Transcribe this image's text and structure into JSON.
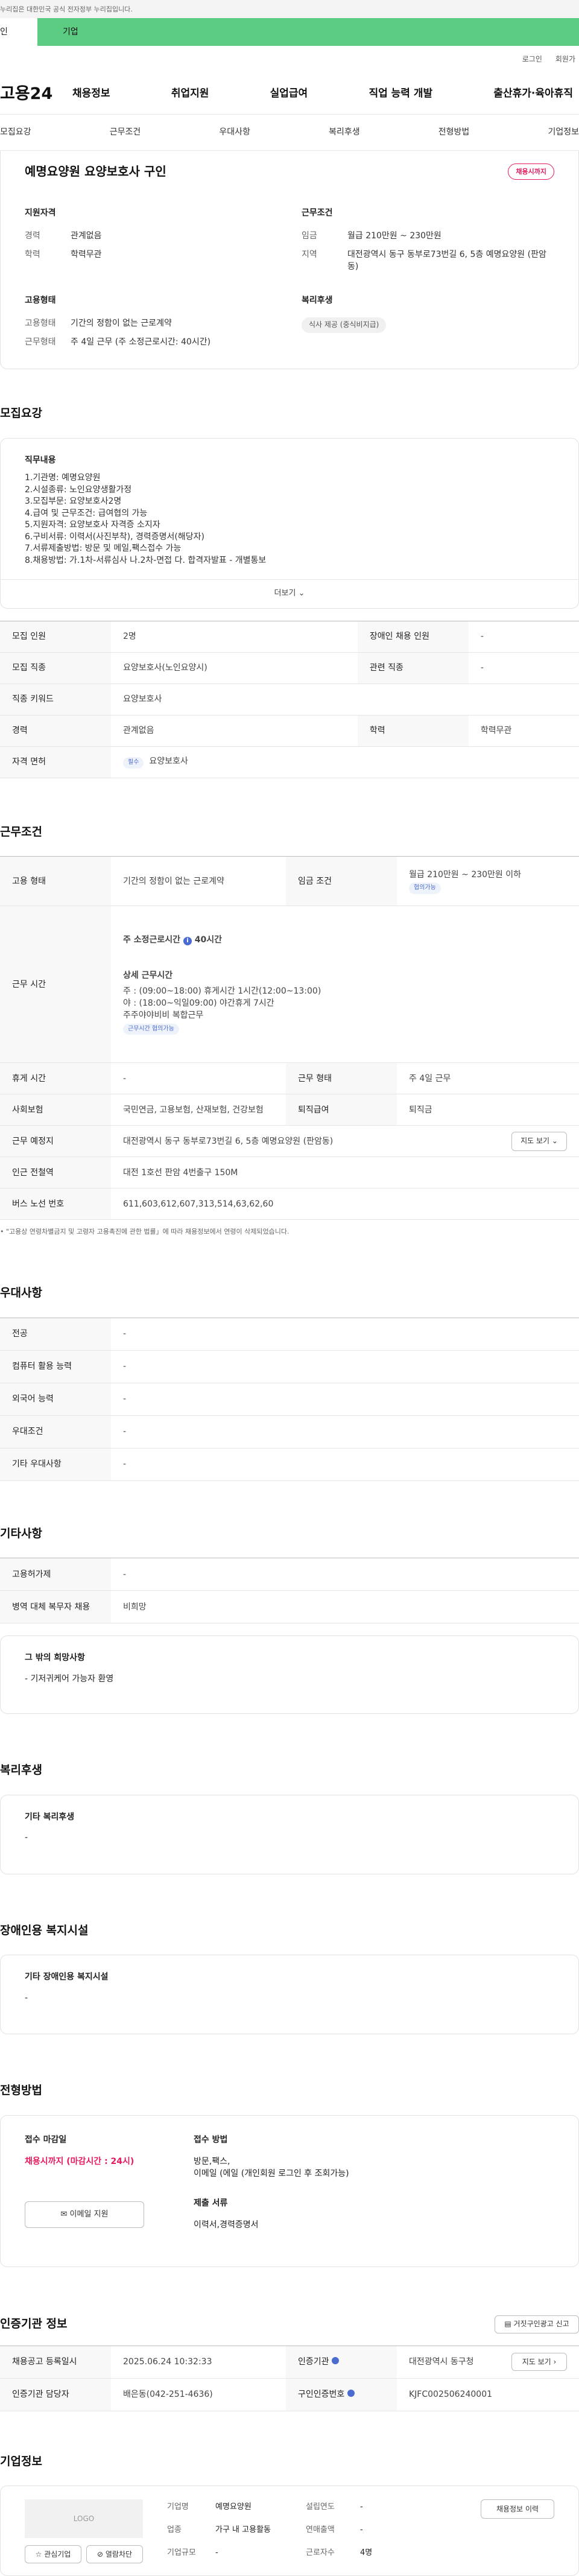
{
  "gov_banner": "누리집은 대한민국 공식 전자정부 누리집입니다.",
  "site_tabs": [
    "인",
    "기업"
  ],
  "util_links": [
    "로그인",
    "회원가"
  ],
  "logo": "고용24",
  "gnb": [
    "채용정보",
    "취업지원",
    "실업급여",
    "직업 능력 개발",
    "출산휴가·육아휴직"
  ],
  "anchors": [
    "모집요강",
    "근무조건",
    "우대사항",
    "복리후생",
    "전형방법",
    "기업정보"
  ],
  "job_title": "예명요양원 요양보호사 구인",
  "status_badge": "채용시까지",
  "summary": {
    "qual_title": "지원자격",
    "qual": [
      {
        "k": "경력",
        "v": "관계없음"
      },
      {
        "k": "학력",
        "v": "학력무관"
      }
    ],
    "cond_title": "근무조건",
    "cond": [
      {
        "k": "임금",
        "v": "월급 210만원 ~ 230만원"
      },
      {
        "k": "지역",
        "v": "대전광역시 동구 동부로73번길 6, 5층 예명요양원 (판암동)"
      }
    ],
    "emp_title": "고용형태",
    "emp": [
      {
        "k": "고용형태",
        "v": "기간의 정함이 없는 근로계약"
      },
      {
        "k": "근무형태",
        "v": "주 4일 근무 (주 소정근로시간: 40시간)"
      }
    ],
    "welfare_title": "복리후생",
    "welfare_chip": "식사 제공 (중식비지급)"
  },
  "req": {
    "title": "모집요강",
    "duty_title": "직무내용",
    "duty_lines": [
      "1.기관명: 예명요양원",
      "2.시설종류: 노인요양생활가정",
      "3.모집부문: 요양보호사2명",
      "4.급여 및 근무조건: 급여협의 가능",
      "5.지원자격: 요양보호사 자격증 소지자",
      "6.구비서류: 이력서(사진부착), 경력증명서(해당자)",
      "7.서류제출방법: 방문 및 메일,팩스접수 가능",
      "8.채용방법: 가.1차-서류심사 나.2차-면접 다. 합격자발표 - 개별통보"
    ],
    "more": "더보기",
    "rows": [
      {
        "k1": "모집 인원",
        "v1": "2명",
        "k2": "장애인 채용 인원",
        "v2": "-"
      },
      {
        "k1": "모집 직종",
        "v1": "요양보호사(노인요양시)",
        "k2": "관련 직종",
        "v2": "-"
      },
      {
        "k1": "직종 키워드",
        "v1": "요양보호사",
        "k2": "",
        "v2": ""
      },
      {
        "k1": "경력",
        "v1": "관계없음",
        "k2": "학력",
        "v2": "학력무관"
      }
    ],
    "license_k": "자격 면허",
    "license_chip": "필수",
    "license_v": "요양보호사"
  },
  "cond": {
    "title": "근무조건",
    "emp_k": "고용 형태",
    "emp_v": "기간의 정함이 없는 근로계약",
    "wage_k": "임금 조건",
    "wage_v": "월급 210만원 ~ 230만원 이하",
    "wage_chip": "협의가능",
    "hours_k": "근무 시간",
    "hours_main": "주 소정근로시간",
    "hours_main_v": "40시간",
    "hours_info_icon": "i",
    "hours_detail_title": "상세 근무시간",
    "hours_lines": [
      "주 : (09:00~18:00) 휴게시간 1시간(12:00~13:00)",
      "야 : (18:00~익일09:00) 야간휴게 7시간",
      "주주야야비비 복합근무"
    ],
    "hours_chip": "근무시간 협의가능",
    "rows": [
      {
        "k1": "휴게 시간",
        "v1": "-",
        "k2": "근무 형태",
        "v2": "주 4일 근무"
      },
      {
        "k1": "사회보험",
        "v1": "국민연금, 고용보험, 산재보험, 건강보험",
        "k2": "퇴직급여",
        "v2": "퇴직금"
      }
    ],
    "place_k": "근무 예정지",
    "place_v": "대전광역시 동구 동부로73번길 6, 5층 예명요양원 (판암동)",
    "map_btn": "지도 보기",
    "subway_k": "인근 전철역",
    "subway_v": "대전 1호선 판암 4번출구 150M",
    "bus_k": "버스 노선 번호",
    "bus_v": "611,603,612,607,313,514,63,62,60",
    "note": "\"고용상 연령차별금지 및 고령자 고용촉진에 관한 법률」에 따라 채용정보에서 연령이 삭제되었습니다."
  },
  "pref": {
    "title": "우대사항",
    "rows": [
      {
        "k": "전공",
        "v": "-"
      },
      {
        "k": "컴퓨터 활용 능력",
        "v": "-"
      },
      {
        "k": "외국어 능력",
        "v": "-"
      },
      {
        "k": "우대조건",
        "v": "-"
      },
      {
        "k": "기타 우대사항",
        "v": "-"
      }
    ]
  },
  "etc": {
    "title": "기타사항",
    "rows": [
      {
        "k": "고용허가제",
        "v": "-"
      },
      {
        "k": "병역 대체 복무자 채용",
        "v": "비희망"
      }
    ],
    "wish_title": "그 밖의 희망사항",
    "wish_v": "- 기저귀케어 가능자 환영"
  },
  "welfare": {
    "title": "복리후생",
    "box_title": "기타 복리후생",
    "box_v": "-"
  },
  "disab": {
    "title": "장애인용 복지시설",
    "box_title": "기타 장애인용 복지시설",
    "box_v": "-"
  },
  "proc": {
    "title": "전형방법",
    "deadline_title": "접수 마감일",
    "deadline_v": "채용시까지 (마감시간 : 24시)",
    "email_btn": "이메일 지원",
    "method_title": "접수 방법",
    "method_v": "방문,팩스,",
    "method_v2": "이메일 (에일 (개인회원 로그인 후 조회가능)",
    "docs_title": "제출 서류",
    "docs_v": "이력서,경력증명서"
  },
  "cert": {
    "title": "인증기관 정보",
    "copy_btn": "거짓구인광고 신고",
    "rows": [
      {
        "k1": "채용공고 등록일시",
        "v1": "2025.06.24 10:32:33",
        "k2": "인증기관",
        "v2": "대전광역시 동구청"
      },
      {
        "k1": "인증기관 담당자",
        "v1": "배은동(042-251-4636)",
        "k2": "구인인증번호",
        "v2": "KJFC002506240001"
      }
    ],
    "map_btn": "지도 보기"
  },
  "company": {
    "title": "기업정보",
    "logo": "LOGO",
    "fav_btn": "관심기업",
    "block_btn": "열람차단",
    "fields": [
      {
        "k": "기업명",
        "v": "예명요양원"
      },
      {
        "k": "업종",
        "v": "가구 내 고용활동"
      },
      {
        "k": "기업규모",
        "v": "-"
      }
    ],
    "fields2": [
      {
        "k": "설립연도",
        "v": "-"
      },
      {
        "k": "연매출액",
        "v": "-"
      },
      {
        "k": "근로자수",
        "v": "4명"
      }
    ],
    "jobs_btn": "채용정보 이력"
  }
}
